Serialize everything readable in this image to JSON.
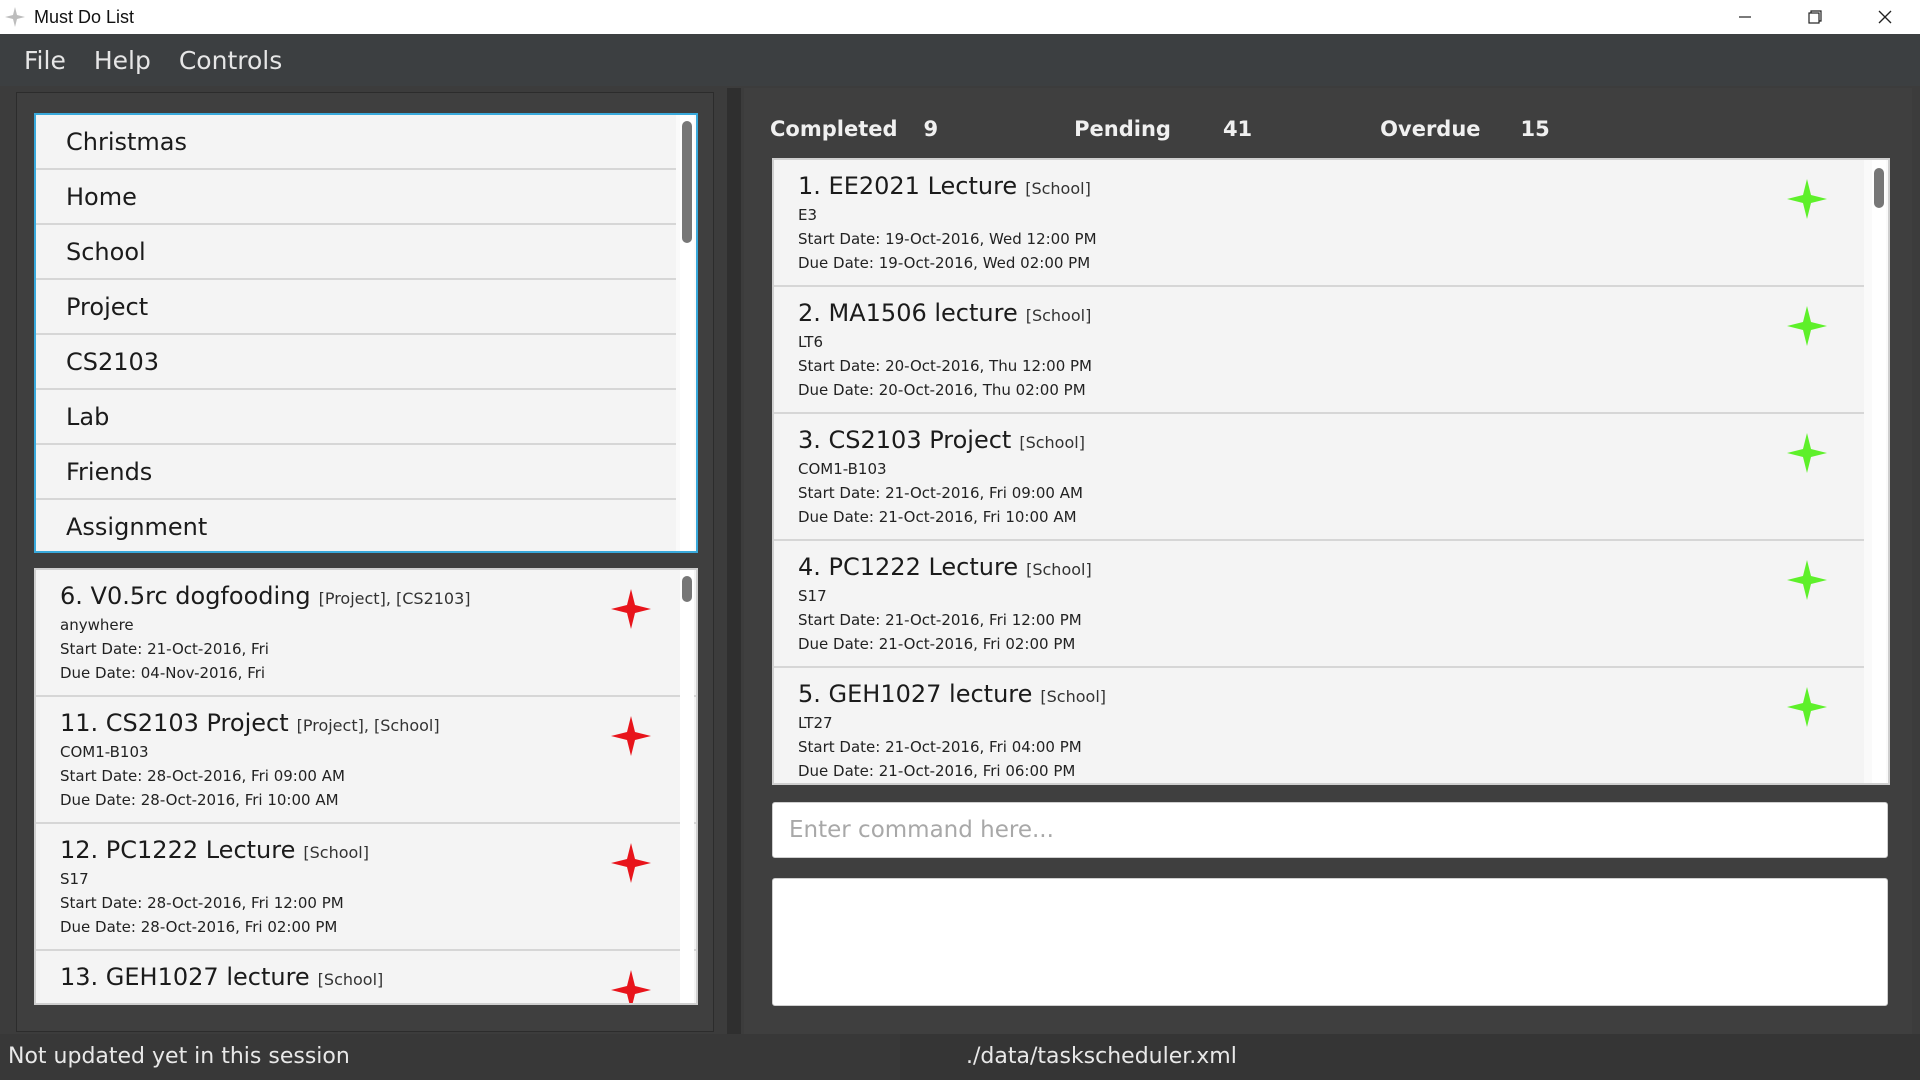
{
  "window": {
    "title": "Must Do List",
    "app_icon": "star-logo-icon",
    "controls": [
      "minimize-icon",
      "restore-icon",
      "close-icon"
    ]
  },
  "menu": {
    "items": [
      "File",
      "Help",
      "Controls"
    ]
  },
  "tags": {
    "items": [
      "Christmas",
      "Home",
      "School",
      "Project",
      "CS2103",
      "Lab",
      "Friends",
      "Assignment"
    ]
  },
  "left_tasks": [
    {
      "name": "6. V0.5rc dogfooding",
      "tags": "[Project], [CS2103]",
      "location": "anywhere",
      "start": "Start Date: 21-Oct-2016, Fri",
      "due": "Due Date: 04-Nov-2016, Fri"
    },
    {
      "name": "11. CS2103 Project",
      "tags": "[Project], [School]",
      "location": "COM1-B103",
      "start": "Start Date: 28-Oct-2016, Fri 09:00 AM",
      "due": "Due Date: 28-Oct-2016, Fri 10:00 AM"
    },
    {
      "name": "12. PC1222 Lecture",
      "tags": "[School]",
      "location": "S17",
      "start": "Start Date: 28-Oct-2016, Fri 12:00 PM",
      "due": "Due Date: 28-Oct-2016, Fri 02:00 PM"
    },
    {
      "name": "13. GEH1027 lecture",
      "tags": "[School]",
      "location": "",
      "start": "",
      "due": ""
    }
  ],
  "stats": {
    "completed_label": "Completed",
    "completed": "9",
    "pending_label": "Pending",
    "pending": "41",
    "overdue_label": "Overdue",
    "overdue": "15"
  },
  "right_tasks": [
    {
      "name": "1. EE2021 Lecture",
      "tags": "[School]",
      "location": "E3",
      "start": "Start Date: 19-Oct-2016, Wed 12:00 PM",
      "due": "Due Date: 19-Oct-2016, Wed 02:00 PM"
    },
    {
      "name": "2. MA1506 lecture",
      "tags": "[School]",
      "location": "LT6",
      "start": "Start Date: 20-Oct-2016, Thu 12:00 PM",
      "due": "Due Date: 20-Oct-2016, Thu 02:00 PM"
    },
    {
      "name": "3. CS2103 Project",
      "tags": "[School]",
      "location": "COM1-B103",
      "start": "Start Date: 21-Oct-2016, Fri 09:00 AM",
      "due": "Due Date: 21-Oct-2016, Fri 10:00 AM"
    },
    {
      "name": "4. PC1222 Lecture",
      "tags": "[School]",
      "location": "S17",
      "start": "Start Date: 21-Oct-2016, Fri 12:00 PM",
      "due": "Due Date: 21-Oct-2016, Fri 02:00 PM"
    },
    {
      "name": "5. GEH1027 lecture",
      "tags": "[School]",
      "location": "LT27",
      "start": "Start Date: 21-Oct-2016, Fri 04:00 PM",
      "due": "Due Date: 21-Oct-2016, Fri 06:00 PM"
    }
  ],
  "command": {
    "placeholder": "Enter command here...",
    "value": ""
  },
  "result": {
    "text": ""
  },
  "status": {
    "sync": "Not updated yet in this session",
    "file": "./data/taskscheduler.xml"
  },
  "colors": {
    "overdue_star": "#e8141b",
    "pending_star": "#5ef02a",
    "selection_border": "#39a9db"
  }
}
